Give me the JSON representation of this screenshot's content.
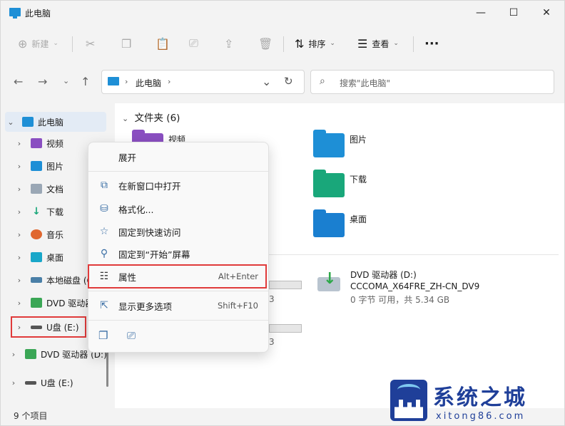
{
  "window": {
    "title": "此电脑"
  },
  "toolbar": {
    "new_label": "新建",
    "sort_label": "排序",
    "view_label": "查看"
  },
  "address": {
    "crumb": "此电脑"
  },
  "search": {
    "placeholder": "搜索\"此电脑\""
  },
  "sidebar": {
    "items": [
      {
        "label": "此电脑",
        "icon": "monitor-icon"
      },
      {
        "label": "视频",
        "icon": "video-folder-icon"
      },
      {
        "label": "图片",
        "icon": "pictures-folder-icon"
      },
      {
        "label": "文档",
        "icon": "documents-folder-icon"
      },
      {
        "label": "下载",
        "icon": "download-icon"
      },
      {
        "label": "音乐",
        "icon": "music-icon"
      },
      {
        "label": "桌面",
        "icon": "desktop-icon"
      },
      {
        "label": "本地磁盘 (C",
        "icon": "drive-icon"
      },
      {
        "label": "DVD 驱动器",
        "icon": "dvd-icon"
      },
      {
        "label": "U盘 (E:)",
        "icon": "usb-icon"
      },
      {
        "label": "DVD 驱动器 (D:)",
        "icon": "dvd-icon"
      },
      {
        "label": "U盘 (E:)",
        "icon": "usb-icon"
      }
    ]
  },
  "content": {
    "folders_header": "文件夹 (6)",
    "folders": [
      {
        "label": "视频",
        "color": "#8a4fc1"
      },
      {
        "label": "图片",
        "color": "#1e8fd6"
      },
      {
        "label": "下载",
        "color": "#19a77a"
      },
      {
        "label": "桌面",
        "color": "#1a7fd0"
      }
    ],
    "dvd": {
      "name": "DVD 驱动器 (D:)",
      "volume": "CCCOMA_X64FRE_ZH-CN_DV9",
      "space": "0 字节 可用，共 5.34 GB"
    },
    "drive_partial": [
      "3",
      "3"
    ]
  },
  "context_menu": {
    "items": [
      {
        "label": "展开",
        "shortcut": ""
      },
      {
        "label": "在新窗口中打开",
        "shortcut": ""
      },
      {
        "label": "格式化...",
        "shortcut": ""
      },
      {
        "label": "固定到快速访问",
        "shortcut": ""
      },
      {
        "label": "固定到“开始”屏幕",
        "shortcut": ""
      },
      {
        "label": "属性",
        "shortcut": "Alt+Enter"
      },
      {
        "label": "显示更多选项",
        "shortcut": "Shift+F10"
      }
    ]
  },
  "status": {
    "item_count": "9 个项目"
  },
  "watermark": {
    "brand": "系统之城",
    "url": "xitong86.com"
  },
  "colors": {
    "highlight_red": "#e03a3a",
    "accent": "#1e8fd6"
  }
}
